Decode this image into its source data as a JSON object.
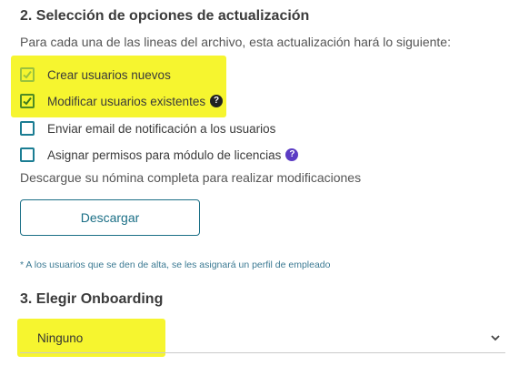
{
  "section2": {
    "title": "2. Selección de opciones de actualización",
    "intro": "Para cada una de las lineas del archivo, esta actualización hará lo siguiente:",
    "options": [
      {
        "label": "Crear usuarios nuevos",
        "checked": true,
        "highlighted": true,
        "help": false
      },
      {
        "label": "Modificar usuarios existentes",
        "checked": true,
        "highlighted": true,
        "help": true,
        "help_icon": "question-circle-icon",
        "help_color": "#222222"
      },
      {
        "label": "Enviar email de notificación a los usuarios",
        "checked": false,
        "highlighted": false,
        "help": false
      },
      {
        "label": "Asignar permisos para módulo de licencias",
        "checked": false,
        "highlighted": false,
        "help": true,
        "help_icon": "question-circle-icon",
        "help_color": "#5b3cc4"
      }
    ],
    "download_text": "Descargue su nómina completa para realizar modificaciones",
    "download_button": "Descargar",
    "note": "* A los usuarios que se den de alta, se les asignará un perfil de empleado"
  },
  "section3": {
    "title": "3. Elegir Onboarding",
    "select_value": "Ninguno",
    "select_icon": "chevron-down-icon"
  },
  "colors": {
    "accent": "#1b6f86",
    "highlight": "#f6f52f",
    "note": "#3c7a93"
  }
}
